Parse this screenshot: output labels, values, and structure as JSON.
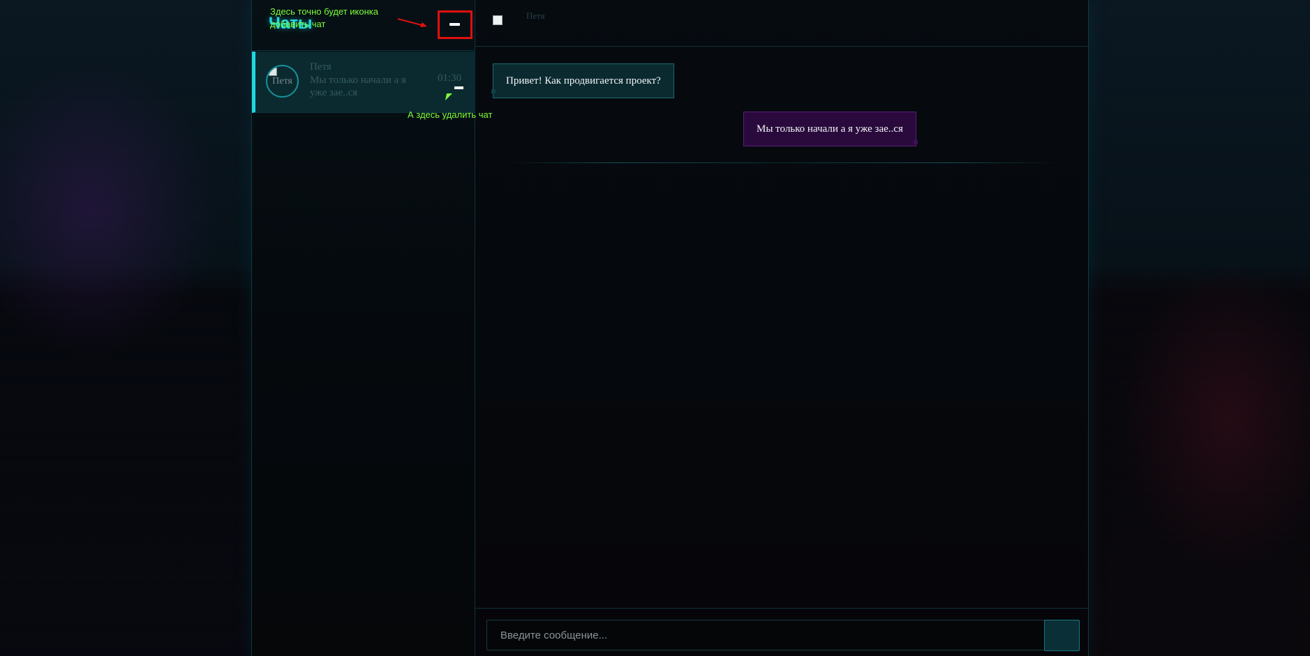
{
  "sidebar": {
    "title": "Чаты",
    "chats": [
      {
        "name": "Петя",
        "avatar_alt": "Петя",
        "preview": "Мы только начали а я уже зае..ся",
        "time": "01:30"
      }
    ]
  },
  "annotations": {
    "add_chat_note": "Здесь точно будет иконка добавить чат",
    "delete_chat_note": "А здесь удалить чат"
  },
  "chat": {
    "header_avatar_alt": "Петя",
    "messages": [
      {
        "direction": "incoming",
        "text": "Привет! Как продвигается проект?"
      },
      {
        "direction": "outgoing",
        "text": "Мы только начали а я уже зае..ся"
      }
    ]
  },
  "composer": {
    "placeholder": "Введите сообщение..."
  },
  "colors": {
    "accent": "#1fd8e0",
    "annotation_text": "#7dff3a",
    "annotation_highlight": "#e01010",
    "incoming_bubble": "#0b2a30",
    "outgoing_bubble": "#2a0a3c"
  },
  "icons": {
    "add_chat": "minus-icon",
    "delete_chat": "minus-icon",
    "send": "send-icon"
  }
}
